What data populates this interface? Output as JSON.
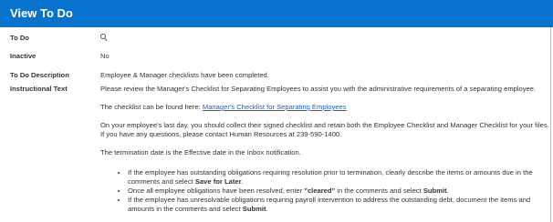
{
  "header": {
    "title": "View To Do"
  },
  "fields": {
    "todo": {
      "label": "To Do"
    },
    "inactive": {
      "label": "Inactive",
      "value": "No"
    },
    "description": {
      "label": "To Do Description",
      "value": "Employee & Manager checklists have been completed."
    },
    "instructional": {
      "label": "Instructional Text",
      "p1": "Please review the Manager's Checklist for Separating Employees to assist you with the administrative requirements of a separating employee.",
      "p2_prefix": "The checklist can be found here: ",
      "p2_link": "Manager's Checklist for Separating Employees",
      "p3": "On your employee's last day, you should collect their signed checklist and retain both the Employee Checklist and Manager Checklist for your files. If you have any questions, please contact Human Resources at 239-590-1400.",
      "p4": "The termination date is the Effective date in the Inbox notification.",
      "b1_text": "If the employee has outstanding obligations requiring resolution prior to termination, clearly describe the items or amounts due in the comments and select ",
      "b1_bold": "Save for Later",
      "b1_end": ".",
      "b2_text": "Once all employee obligations have been resolved, enter ",
      "b2_bold1": "\"cleared\"",
      "b2_mid": " in the comments and select ",
      "b2_bold2": "Submit",
      "b2_end": ".",
      "b3_text": "If the employee has unresolvable obligations requiring payroll intervention to address the outstanding debt, document the items and amounts in the comments and select ",
      "b3_bold": "Submit",
      "b3_end": "."
    }
  },
  "icons": {
    "todo_value_icon": "search-icon"
  }
}
